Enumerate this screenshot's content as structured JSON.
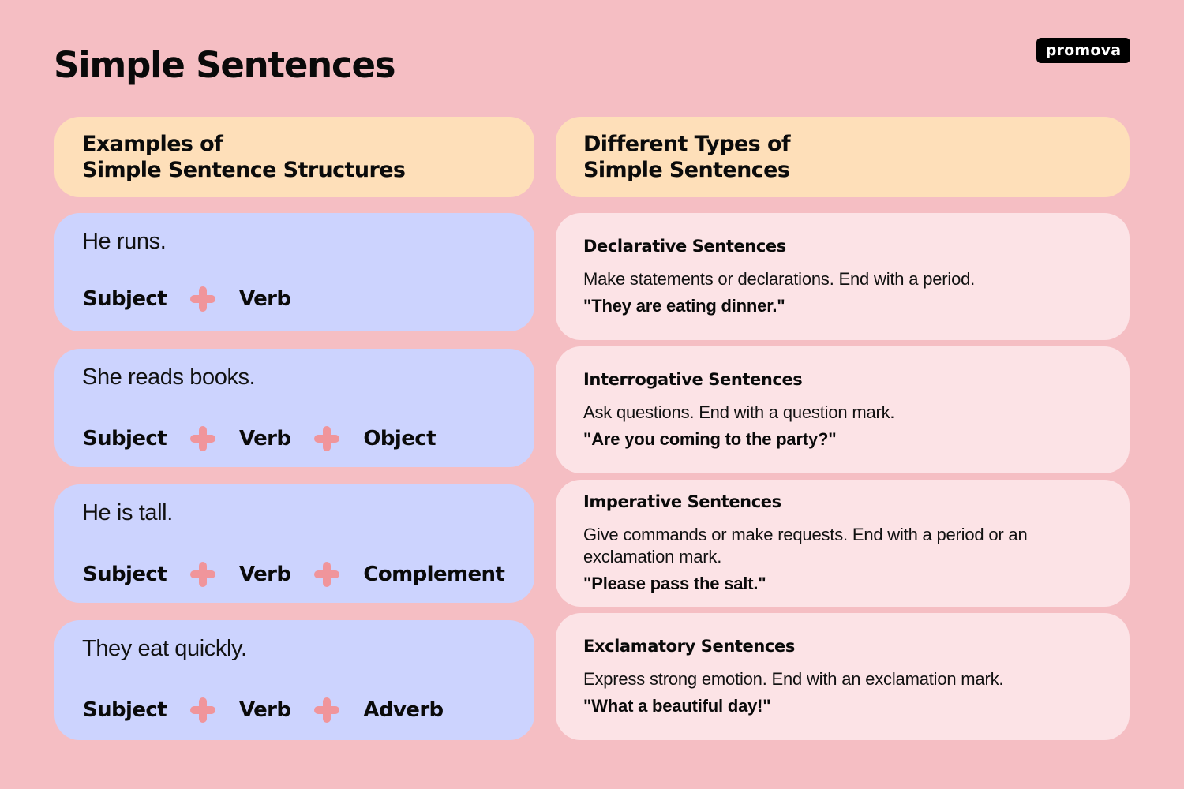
{
  "page": {
    "title": "Simple Sentences",
    "logo": "promova"
  },
  "colors": {
    "background": "#f5bec3",
    "header_box": "#fedfb9",
    "example_box": "#ccd3fe",
    "type_box": "#fce3e6",
    "plus_icon": "#f0959b",
    "logo_bg": "#000000"
  },
  "left_column": {
    "header": [
      "Examples of",
      "Simple Sentence Structures"
    ],
    "examples": [
      {
        "sentence": "He runs.",
        "parts": [
          "Subject",
          "Verb"
        ]
      },
      {
        "sentence": "She reads books.",
        "parts": [
          "Subject",
          "Verb",
          "Object"
        ]
      },
      {
        "sentence": "He is tall.",
        "parts": [
          "Subject",
          "Verb",
          "Complement"
        ]
      },
      {
        "sentence": "They eat quickly.",
        "parts": [
          "Subject",
          "Verb",
          "Adverb"
        ]
      }
    ]
  },
  "right_column": {
    "header": [
      "Different Types of",
      "Simple Sentences"
    ],
    "types": [
      {
        "title": "Declarative Sentences",
        "description": "Make statements or declarations. End with a period.",
        "example": "\"They are eating dinner.\""
      },
      {
        "title": "Interrogative Sentences",
        "description": "Ask questions. End with a question mark.",
        "example": "\"Are you coming to the party?\""
      },
      {
        "title": "Imperative Sentences",
        "description": "Give commands or make requests. End with a period or an exclamation mark.",
        "example": "\"Please pass the salt.\""
      },
      {
        "title": "Exclamatory Sentences",
        "description": "Express strong emotion. End with an exclamation mark.",
        "example": "\"What a beautiful day!\""
      }
    ]
  }
}
